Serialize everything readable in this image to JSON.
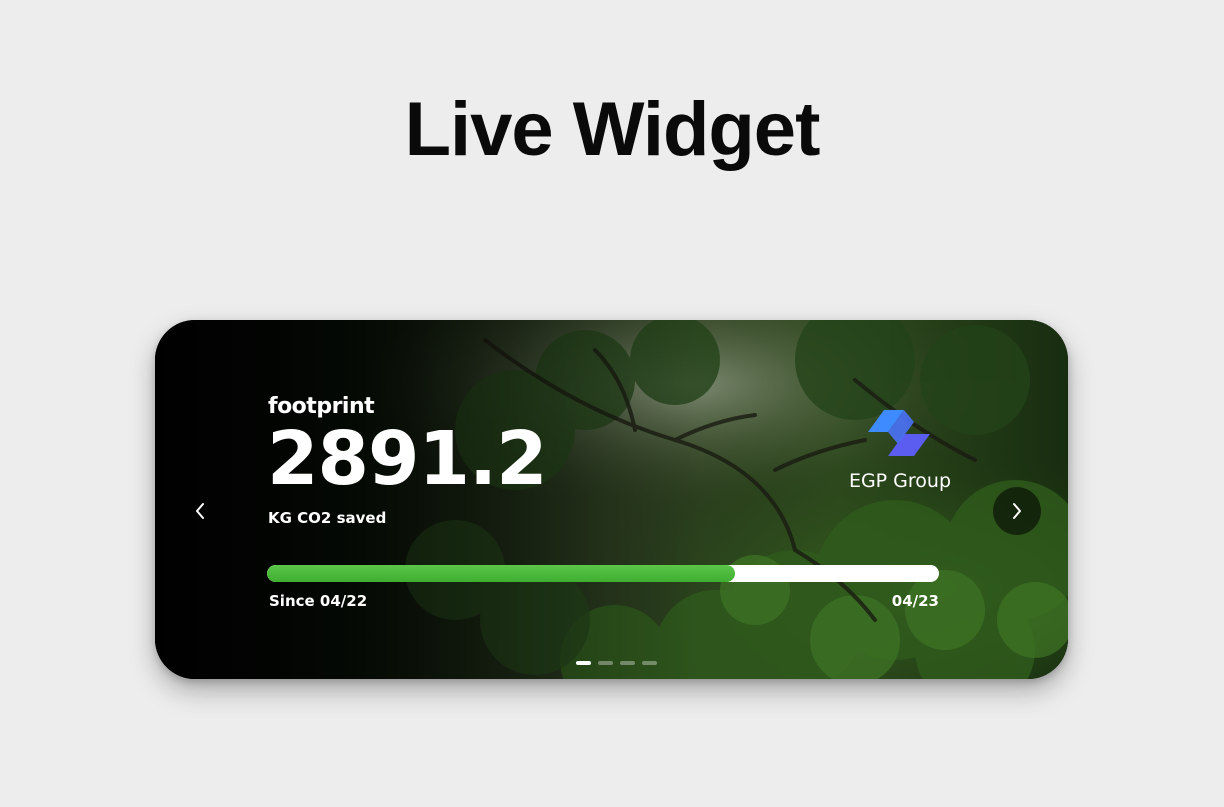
{
  "heading": "Live Widget",
  "widget": {
    "brand": "footprint",
    "metric_value": "2891.2",
    "metric_label": "KG CO2 saved",
    "company": {
      "name": "EGP Group",
      "logo_icon": "egp-group-logo",
      "logo_colors": [
        "#3d8bff",
        "#5b5cf0"
      ]
    },
    "progress": {
      "fraction": 0.697,
      "start_label": "Since 04/22",
      "end_label": "04/23",
      "fill_color": "#4cbb3a"
    },
    "nav": {
      "prev_icon": "chevron-left-icon",
      "next_icon": "chevron-right-icon"
    },
    "pagination": {
      "total": 4,
      "active_index": 0
    },
    "background_icon": "forest-background"
  }
}
